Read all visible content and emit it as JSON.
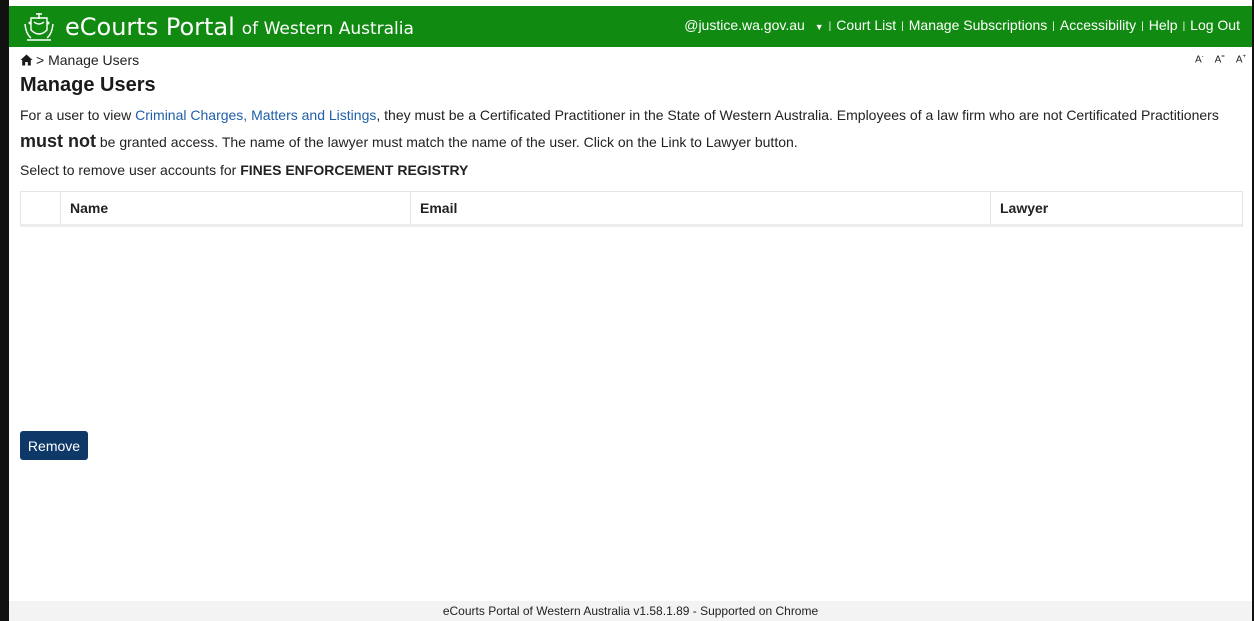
{
  "header": {
    "brand_main": "eCourts Portal",
    "brand_sub": "of Western Australia",
    "nav": {
      "account": "@justice.wa.gov.au",
      "court_list": "Court List",
      "manage_subscriptions": "Manage Subscriptions",
      "accessibility": "Accessibility",
      "help": "Help",
      "logout": "Log Out"
    }
  },
  "breadcrumb": {
    "separator": ">",
    "current": "Manage Users"
  },
  "font_controls": {
    "decrease": "A",
    "reset": "A",
    "increase": "A",
    "decrease_sup": "-",
    "reset_sup": "=",
    "increase_sup": "+"
  },
  "page": {
    "title": "Manage Users",
    "intro_pre": "For a user to view ",
    "intro_link": "Criminal Charges, Matters and Listings",
    "intro_mid": ", they must be a Certificated Practitioner in the State of Western Australia. Employees of a law firm who are not Certificated Practitioners ",
    "intro_emph": "must not",
    "intro_post": " be granted access. The name of the lawyer must match the name of the user. Click on the Link to Lawyer button.",
    "select_prefix": "Select to remove user accounts for ",
    "select_org": "FINES ENFORCEMENT REGISTRY"
  },
  "table": {
    "columns": [
      "",
      "Name",
      "Email",
      "Lawyer"
    ],
    "rows": []
  },
  "remove_label": "Remove",
  "footer": "eCourts Portal of Western Australia v1.58.1.89 - Supported on Chrome",
  "colors": {
    "header_green": "#108a10",
    "button_navy": "#0e3868",
    "link_blue": "#1f5fa8"
  }
}
